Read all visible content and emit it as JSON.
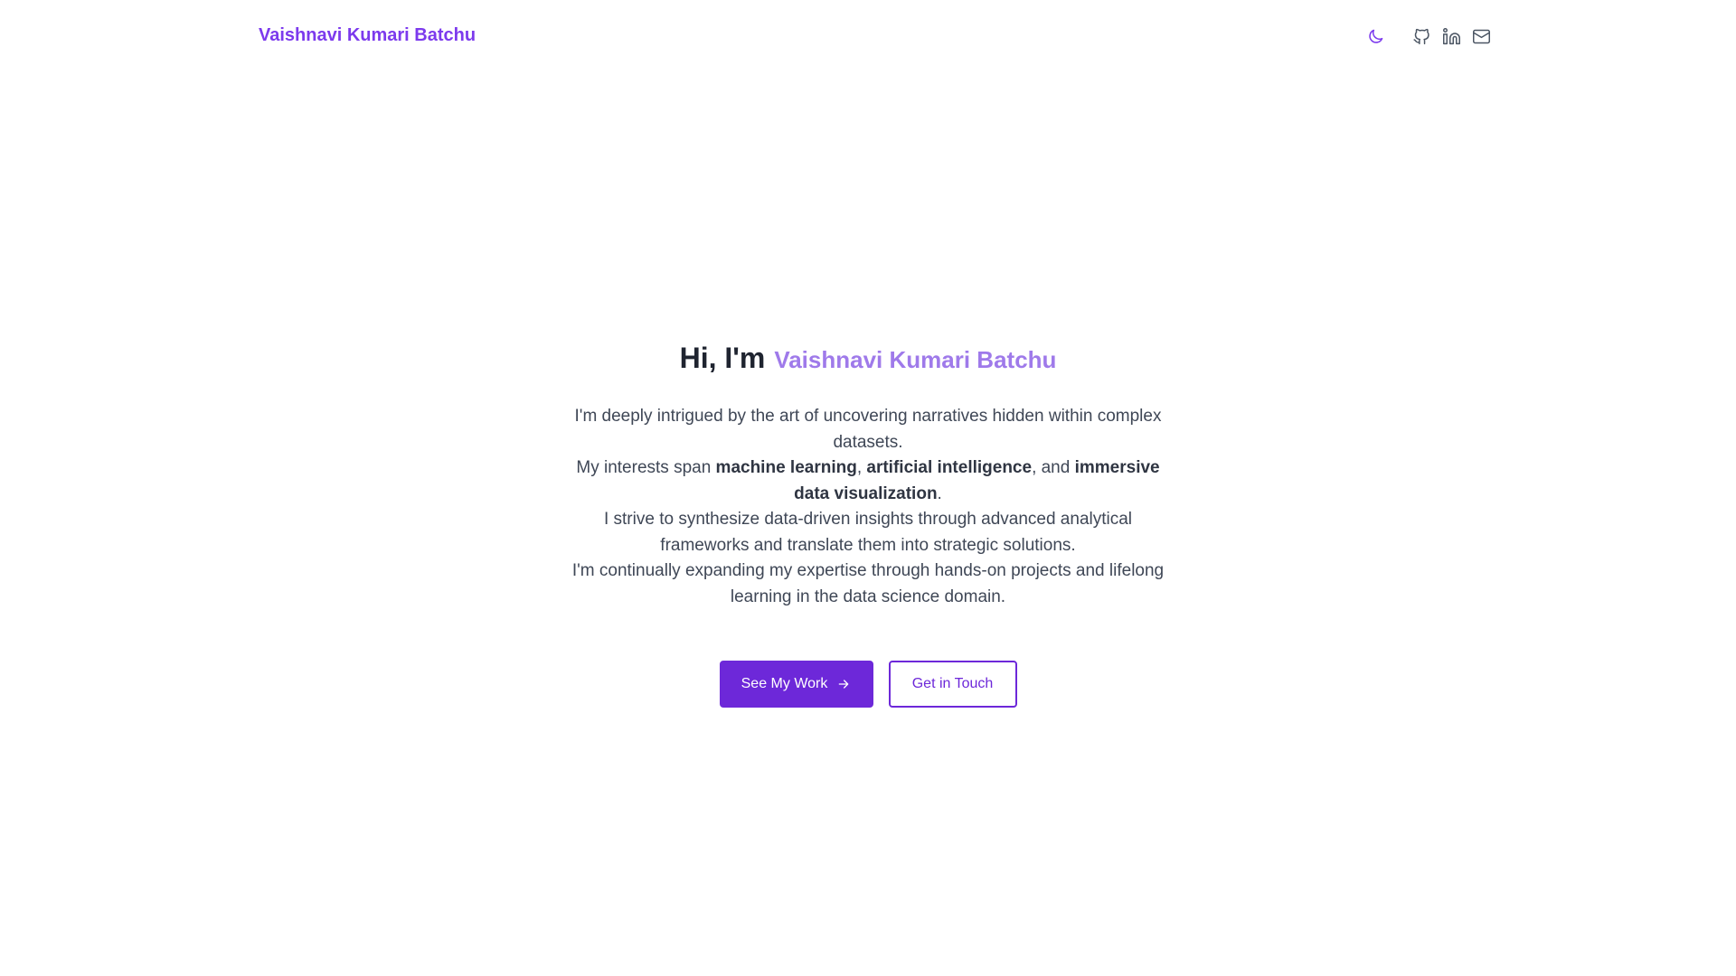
{
  "header": {
    "brand": "Vaishnavi Kumari Batchu",
    "icons": {
      "theme": "moon-icon",
      "github": "github-icon",
      "linkedin": "linkedin-icon",
      "email": "mail-icon"
    }
  },
  "hero": {
    "greeting": "Hi, I'm",
    "name": "Vaishnavi Kumari Batchu",
    "line1": "I'm deeply intrigued by the art of uncovering narratives hidden within complex datasets.",
    "line2_prefix": "My interests span ",
    "line2_ml": "machine learning",
    "line2_sep1": ", ",
    "line2_ai": "artificial intelligence",
    "line2_sep2": ", and ",
    "line2_viz": "immersive data visualization",
    "line2_end": ".",
    "line3": "I strive to synthesize data-driven insights through advanced analytical frameworks and translate them into strategic solutions.",
    "line4": "I'm continually expanding my expertise through hands-on projects and lifelong learning in the data science domain."
  },
  "cta": {
    "primary_label": "See My Work",
    "primary_icon": "arrow-right-icon",
    "secondary_label": "Get in Touch"
  },
  "colors": {
    "accent": "#7c3aed",
    "accent_dark": "#6d28d9",
    "name_light": "#9f7aea",
    "text": "#3f4756",
    "icon_gray": "#4b5563"
  }
}
